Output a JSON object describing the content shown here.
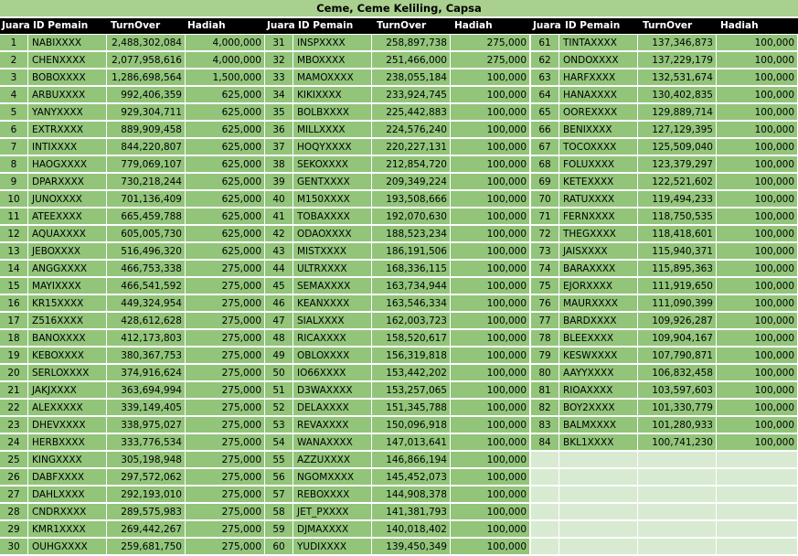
{
  "title": "Ceme, Ceme Keliling, Capsa",
  "headers": [
    "Juara",
    "ID Pemain",
    "TurnOver",
    "Hadiah"
  ],
  "blocks": [
    [
      [
        "1",
        "NABIXXXX",
        "2,488,302,084",
        "4,000,000"
      ],
      [
        "2",
        "CHENXXXX",
        "2,077,958,616",
        "4,000,000"
      ],
      [
        "3",
        "BOBOXXXX",
        "1,286,698,564",
        "1,500,000"
      ],
      [
        "4",
        "ARBUXXXX",
        "992,406,359",
        "625,000"
      ],
      [
        "5",
        "YANYXXXX",
        "929,304,711",
        "625,000"
      ],
      [
        "6",
        "EXTRXXXX",
        "889,909,458",
        "625,000"
      ],
      [
        "7",
        "INTIXXXX",
        "844,220,807",
        "625,000"
      ],
      [
        "8",
        "HAOGXXXX",
        "779,069,107",
        "625,000"
      ],
      [
        "9",
        "DPARXXXX",
        "730,218,244",
        "625,000"
      ],
      [
        "10",
        "JUNOXXXX",
        "701,136,409",
        "625,000"
      ],
      [
        "11",
        "ATEEXXXX",
        "665,459,788",
        "625,000"
      ],
      [
        "12",
        "AQUAXXXX",
        "605,005,730",
        "625,000"
      ],
      [
        "13",
        "JEBOXXXX",
        "516,496,320",
        "625,000"
      ],
      [
        "14",
        "ANGGXXXX",
        "466,753,338",
        "275,000"
      ],
      [
        "15",
        "MAYIXXXX",
        "466,541,592",
        "275,000"
      ],
      [
        "16",
        "KR15XXXX",
        "449,324,954",
        "275,000"
      ],
      [
        "17",
        "Z516XXXX",
        "428,612,628",
        "275,000"
      ],
      [
        "18",
        "BANOXXXX",
        "412,173,803",
        "275,000"
      ],
      [
        "19",
        "KEBOXXXX",
        "380,367,753",
        "275,000"
      ],
      [
        "20",
        "SERLOXXXX",
        "374,916,624",
        "275,000"
      ],
      [
        "21",
        "JAKJXXXX",
        "363,694,994",
        "275,000"
      ],
      [
        "22",
        "ALEXXXXX",
        "339,149,405",
        "275,000"
      ],
      [
        "23",
        "DHEVXXXX",
        "338,975,027",
        "275,000"
      ],
      [
        "24",
        "HERBXXXX",
        "333,776,534",
        "275,000"
      ],
      [
        "25",
        "KINGXXXX",
        "305,198,948",
        "275,000"
      ],
      [
        "26",
        "DABFXXXX",
        "297,572,062",
        "275,000"
      ],
      [
        "27",
        "DAHLXXXX",
        "292,193,010",
        "275,000"
      ],
      [
        "28",
        "CNDRXXXX",
        "289,575,983",
        "275,000"
      ],
      [
        "29",
        "KMR1XXXX",
        "269,442,267",
        "275,000"
      ],
      [
        "30",
        "OUHGXXXX",
        "259,681,750",
        "275,000"
      ]
    ],
    [
      [
        "31",
        "INSPXXXX",
        "258,897,738",
        "275,000"
      ],
      [
        "32",
        "MBOXXXX",
        "251,466,000",
        "275,000"
      ],
      [
        "33",
        "MAMOXXXX",
        "238,055,184",
        "100,000"
      ],
      [
        "34",
        "KIKIXXXX",
        "233,924,745",
        "100,000"
      ],
      [
        "35",
        "BOLBXXXX",
        "225,442,883",
        "100,000"
      ],
      [
        "36",
        "MILLXXXX",
        "224,576,240",
        "100,000"
      ],
      [
        "37",
        "HOQYXXXX",
        "220,227,131",
        "100,000"
      ],
      [
        "38",
        "SEKOXXXX",
        "212,854,720",
        "100,000"
      ],
      [
        "39",
        "GENTXXXX",
        "209,349,224",
        "100,000"
      ],
      [
        "40",
        "M150XXXX",
        "193,508,666",
        "100,000"
      ],
      [
        "41",
        "TOBAXXXX",
        "192,070,630",
        "100,000"
      ],
      [
        "42",
        "ODAOXXXX",
        "188,523,234",
        "100,000"
      ],
      [
        "43",
        "MISTXXXX",
        "186,191,506",
        "100,000"
      ],
      [
        "44",
        "ULTRXXXX",
        "168,336,115",
        "100,000"
      ],
      [
        "45",
        "SEMAXXXX",
        "163,734,944",
        "100,000"
      ],
      [
        "46",
        "KEANXXXX",
        "163,546,334",
        "100,000"
      ],
      [
        "47",
        "SIALXXXX",
        "162,003,723",
        "100,000"
      ],
      [
        "48",
        "RICAXXXX",
        "158,520,617",
        "100,000"
      ],
      [
        "49",
        "OBLOXXXX",
        "156,319,818",
        "100,000"
      ],
      [
        "50",
        "IO66XXXX",
        "153,442,202",
        "100,000"
      ],
      [
        "51",
        "D3WAXXXX",
        "153,257,065",
        "100,000"
      ],
      [
        "52",
        "DELAXXXX",
        "151,345,788",
        "100,000"
      ],
      [
        "53",
        "REVAXXXX",
        "150,096,918",
        "100,000"
      ],
      [
        "54",
        "WANAXXXX",
        "147,013,641",
        "100,000"
      ],
      [
        "55",
        "AZZUXXXX",
        "146,866,194",
        "100,000"
      ],
      [
        "56",
        "NGOMXXXX",
        "145,452,073",
        "100,000"
      ],
      [
        "57",
        "REBOXXXX",
        "144,908,378",
        "100,000"
      ],
      [
        "58",
        "JET_PXXXX",
        "141,381,793",
        "100,000"
      ],
      [
        "59",
        "DJMAXXXX",
        "140,018,402",
        "100,000"
      ],
      [
        "60",
        "YUDIXXXX",
        "139,450,349",
        "100,000"
      ]
    ],
    [
      [
        "61",
        "TINTAXXXX",
        "137,346,873",
        "100,000"
      ],
      [
        "62",
        "ONDOXXXX",
        "137,229,179",
        "100,000"
      ],
      [
        "63",
        "HARFXXXX",
        "132,531,674",
        "100,000"
      ],
      [
        "64",
        "HANAXXXX",
        "130,402,835",
        "100,000"
      ],
      [
        "65",
        "OOREXXXX",
        "129,889,714",
        "100,000"
      ],
      [
        "66",
        "BENIXXXX",
        "127,129,395",
        "100,000"
      ],
      [
        "67",
        "TOCOXXXX",
        "125,509,040",
        "100,000"
      ],
      [
        "68",
        "FOLUXXXX",
        "123,379,297",
        "100,000"
      ],
      [
        "69",
        "KETEXXXX",
        "122,521,602",
        "100,000"
      ],
      [
        "70",
        "RATUXXXX",
        "119,494,233",
        "100,000"
      ],
      [
        "71",
        "FERNXXXX",
        "118,750,535",
        "100,000"
      ],
      [
        "72",
        "THEGXXXX",
        "118,418,601",
        "100,000"
      ],
      [
        "73",
        "JAISXXXX",
        "115,940,371",
        "100,000"
      ],
      [
        "74",
        "BARAXXXX",
        "115,895,363",
        "100,000"
      ],
      [
        "75",
        "EJORXXXX",
        "111,919,650",
        "100,000"
      ],
      [
        "76",
        "MAURXXXX",
        "111,090,399",
        "100,000"
      ],
      [
        "77",
        "BARDXXXX",
        "109,926,287",
        "100,000"
      ],
      [
        "78",
        "BLEEXXXX",
        "109,904,167",
        "100,000"
      ],
      [
        "79",
        "KESWXXXX",
        "107,790,871",
        "100,000"
      ],
      [
        "80",
        "AAYYXXXX",
        "106,832,458",
        "100,000"
      ],
      [
        "81",
        "RIOAXXXX",
        "103,597,603",
        "100,000"
      ],
      [
        "82",
        "BOY2XXXX",
        "101,330,779",
        "100,000"
      ],
      [
        "83",
        "BALMXXXX",
        "101,280,933",
        "100,000"
      ],
      [
        "84",
        "BKL1XXXX",
        "100,741,230",
        "100,000"
      ]
    ]
  ]
}
